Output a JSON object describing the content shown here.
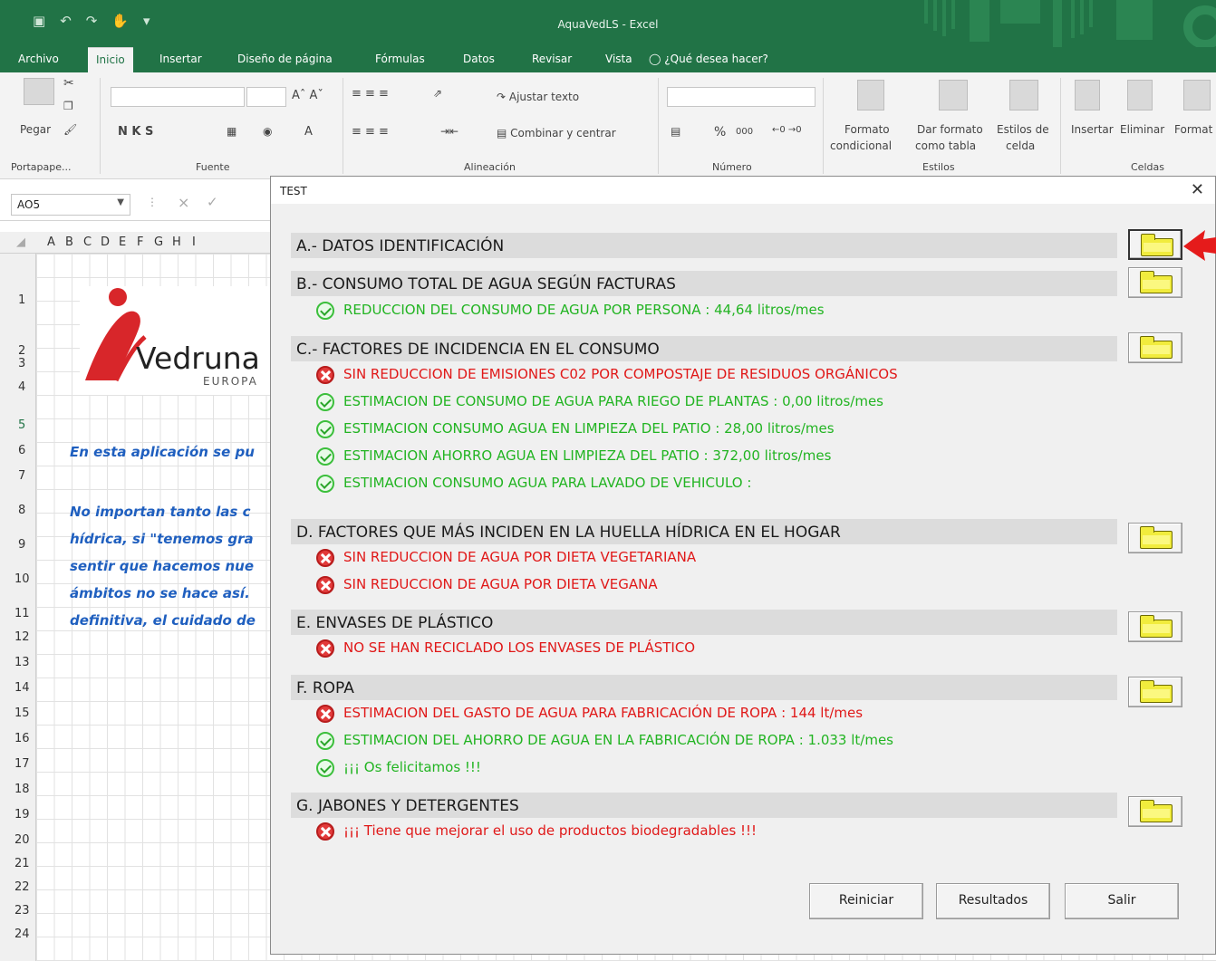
{
  "window": {
    "title": "AquaVedLS - Excel"
  },
  "menu": {
    "tabs": [
      "Archivo",
      "Inicio",
      "Insertar",
      "Diseño de página",
      "Fórmulas",
      "Datos",
      "Revisar",
      "Vista"
    ],
    "tell_me": "¿Qué desea hacer?"
  },
  "ribbon": {
    "paste": "Pegar",
    "clipboard_group": "Portapape...",
    "font_group": "Fuente",
    "font_buttons": "N   K   S",
    "alignment_group": "Alineación",
    "wrap_text": "Ajustar texto",
    "merge_center": "Combinar y centrar",
    "number_group": "Número",
    "percent": "%",
    "thousands": "000",
    "cond_format_1": "Formato",
    "cond_format_2": "condicional",
    "table_format_1": "Dar formato",
    "table_format_2": "como tabla",
    "cell_styles_1": "Estilos de",
    "cell_styles_2": "celda",
    "styles_group": "Estilos",
    "insert": "Insertar",
    "delete": "Eliminar",
    "format": "Format",
    "cells_group": "Celdas"
  },
  "formula_bar": {
    "name_box": "AO5"
  },
  "sheet": {
    "columns": [
      "A",
      "B",
      "C",
      "D",
      "E",
      "F",
      "G",
      "H",
      "I"
    ],
    "rows": [
      "1",
      "2",
      "3",
      "4",
      "5",
      "6",
      "7",
      "8",
      "9",
      "10",
      "11",
      "12",
      "13",
      "14",
      "15",
      "16",
      "17",
      "18",
      "19",
      "20",
      "21",
      "22",
      "23",
      "24"
    ],
    "logo_text": "Vedruna",
    "logo_sub": "EUROPA",
    "blue_lines": [
      "En esta aplicación se pu",
      "No importan tanto las c",
      "hídrica, si \"tenemos gra",
      "sentir que hacemos nue",
      "ámbitos no se hace así.",
      "definitiva, el cuidado de"
    ]
  },
  "dialog": {
    "title": "TEST",
    "sections": [
      {
        "label": "A.- DATOS IDENTIFICACIÓN",
        "items": []
      },
      {
        "label": "B.- CONSUMO TOTAL DE AGUA SEGÚN FACTURAS",
        "items": [
          {
            "status": "ok",
            "text": "REDUCCION DEL CONSUMO DE AGUA POR PERSONA : 44,64 litros/mes"
          }
        ]
      },
      {
        "label": "C.- FACTORES DE INCIDENCIA EN EL CONSUMO",
        "items": [
          {
            "status": "bad",
            "text": "SIN REDUCCION DE EMISIONES C02 POR COMPOSTAJE DE RESIDUOS ORGÁNICOS"
          },
          {
            "status": "ok",
            "text": "ESTIMACION DE CONSUMO DE AGUA PARA RIEGO DE PLANTAS : 0,00 litros/mes"
          },
          {
            "status": "ok",
            "text": "ESTIMACION CONSUMO AGUA EN LIMPIEZA DEL PATIO : 28,00 litros/mes"
          },
          {
            "status": "ok",
            "text": "ESTIMACION AHORRO AGUA EN LIMPIEZA DEL PATIO : 372,00 litros/mes"
          },
          {
            "status": "ok",
            "text": "ESTIMACION CONSUMO AGUA PARA LAVADO DE VEHICULO :"
          }
        ]
      },
      {
        "label": "D. FACTORES QUE MÁS INCIDEN EN LA HUELLA HÍDRICA EN EL HOGAR",
        "items": [
          {
            "status": "bad",
            "text": "SIN REDUCCION DE AGUA POR DIETA VEGETARIANA"
          },
          {
            "status": "bad",
            "text": "SIN REDUCCION DE AGUA POR DIETA VEGANA"
          }
        ]
      },
      {
        "label": "E. ENVASES DE PLÁSTICO",
        "items": [
          {
            "status": "bad",
            "text": "NO SE HAN RECICLADO LOS ENVASES DE PLÁSTICO"
          }
        ]
      },
      {
        "label": "F. ROPA",
        "items": [
          {
            "status": "bad",
            "text": "ESTIMACION DEL GASTO DE AGUA PARA FABRICACIÓN DE ROPA : 144 lt/mes"
          },
          {
            "status": "ok",
            "text": "ESTIMACION DEL AHORRO DE AGUA EN LA FABRICACIÓN DE ROPA : 1.033 lt/mes"
          },
          {
            "status": "ok",
            "text": "¡¡¡ Os felicitamos !!!"
          }
        ]
      },
      {
        "label": "G. JABONES Y DETERGENTES",
        "items": [
          {
            "status": "bad",
            "text": "¡¡¡ Tiene que mejorar el uso de productos biodegradables !!!"
          }
        ]
      }
    ],
    "buttons": {
      "reset": "Reiniciar",
      "results": "Resultados",
      "exit": "Salir"
    }
  },
  "colors": {
    "excel_green": "#217346",
    "ok_green": "#22b422",
    "bad_red": "#e01818",
    "folder_yellow": "#f1ec3d",
    "annotation_arrow": "#e51b1b"
  }
}
